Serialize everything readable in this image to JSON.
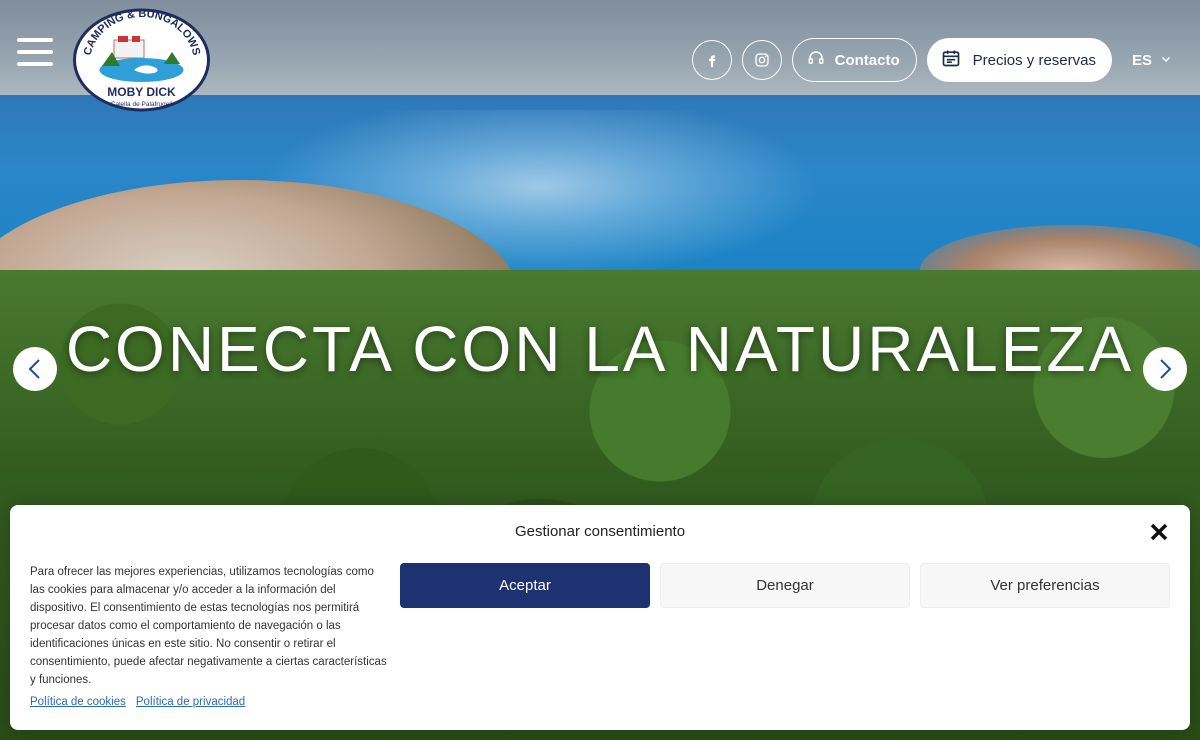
{
  "logo": {
    "top_text": "CAMPING & BUNGALOWS",
    "name": "MOBY DICK",
    "location": "Calella de Palafrugell"
  },
  "header": {
    "contact_label": "Contacto",
    "booking_label": "Precios y reservas",
    "language": "ES"
  },
  "hero": {
    "title": "CONECTA CON LA NATURALEZA"
  },
  "cookie": {
    "title": "Gestionar consentimiento",
    "body": "Para ofrecer las mejores experiencias, utilizamos tecnologías como las cookies para almacenar y/o acceder a la información del dispositivo. El consentimiento de estas tecnologías nos permitirá procesar datos como el comportamiento de navegación o las identificaciones únicas en este sitio. No consentir o retirar el consentimiento, puede afectar negativamente a ciertas características y funciones.",
    "accept_label": "Aceptar",
    "deny_label": "Denegar",
    "preferences_label": "Ver preferencias",
    "cookie_policy_link": "Política de cookies",
    "privacy_policy_link": "Política de privacidad"
  },
  "colors": {
    "accept_bg": "#1e3170",
    "link": "#2e6ab1",
    "logo_navy": "#1e2c5e"
  }
}
